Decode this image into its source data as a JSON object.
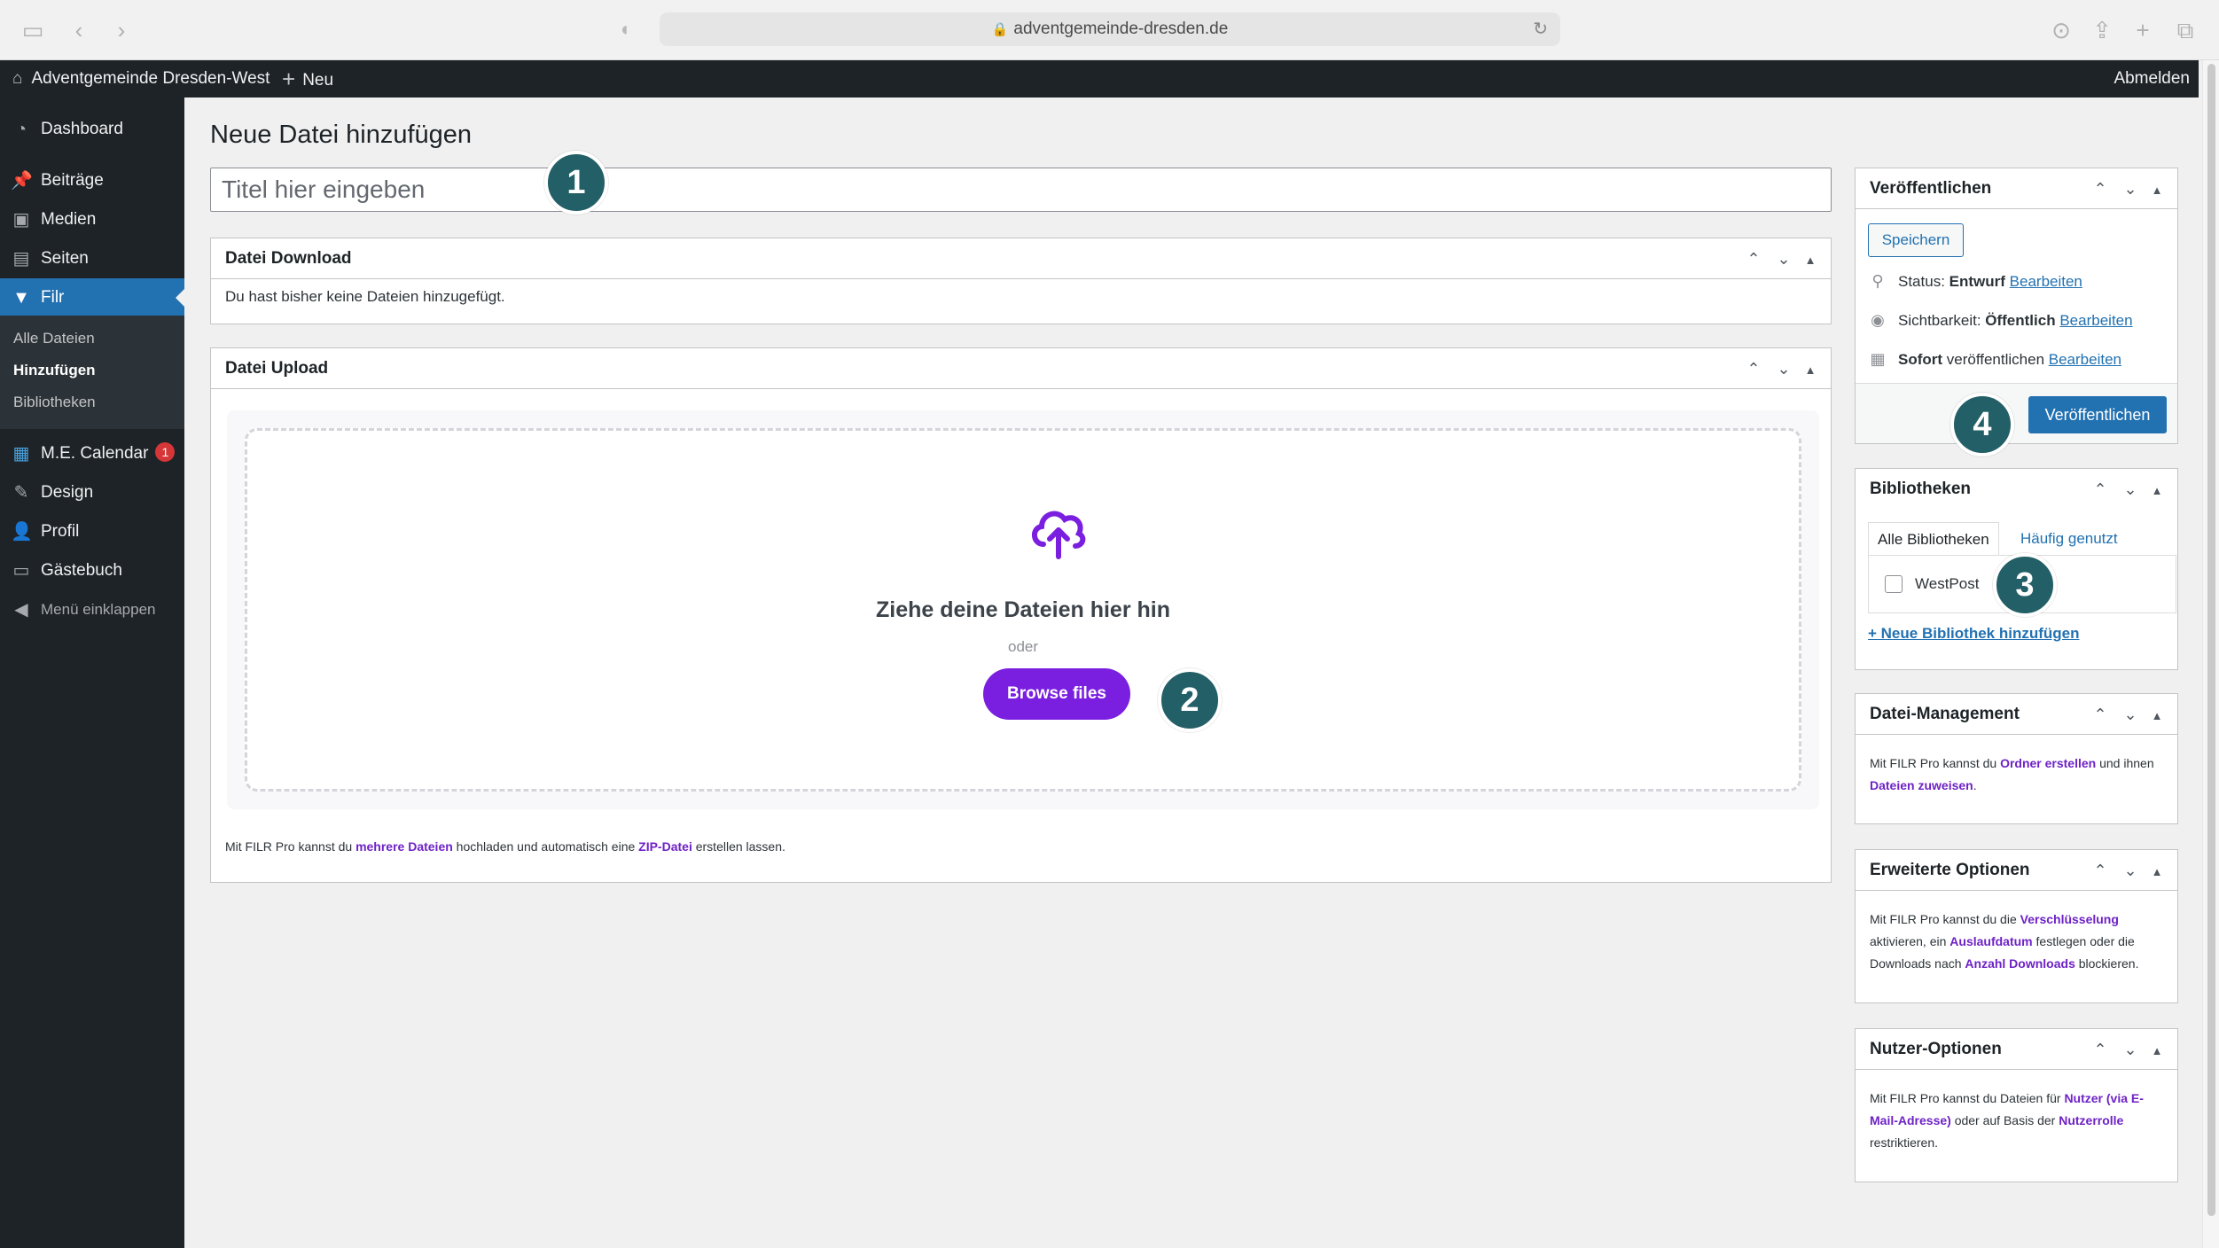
{
  "browser": {
    "url": "adventgemeinde-dresden.de"
  },
  "admin_bar": {
    "site_name": "Adventgemeinde Dresden-West",
    "new_label": "Neu",
    "logout_label": "Abmelden"
  },
  "sidebar": {
    "items": [
      {
        "label": "Dashboard",
        "icon": "dashboard-icon"
      },
      {
        "label": "Beiträge",
        "icon": "pin-icon"
      },
      {
        "label": "Medien",
        "icon": "media-icon"
      },
      {
        "label": "Seiten",
        "icon": "pages-icon"
      },
      {
        "label": "Filr",
        "icon": "filr-icon"
      },
      {
        "label": "M.E. Calendar",
        "icon": "calendar-icon",
        "badge": "1"
      },
      {
        "label": "Design",
        "icon": "brush-icon"
      },
      {
        "label": "Profil",
        "icon": "user-icon"
      },
      {
        "label": "Gästebuch",
        "icon": "guestbook-icon"
      },
      {
        "label": "Menü einklappen",
        "icon": "collapse-icon"
      }
    ],
    "submenu": [
      "Alle Dateien",
      "Hinzufügen",
      "Bibliotheken"
    ]
  },
  "main": {
    "page_title": "Neue Datei hinzufügen",
    "title_placeholder": "Titel hier eingeben",
    "download_box": {
      "title": "Datei Download",
      "empty_text": "Du hast bisher keine Dateien hinzugefügt."
    },
    "upload_box": {
      "title": "Datei Upload",
      "drop_text": "Ziehe deine Dateien hier hin",
      "or_text": "oder",
      "browse_label": "Browse files",
      "note_1": "Mit FILR Pro kannst du ",
      "note_link_1": "mehrere Dateien",
      "note_2": " hochladen und automatisch eine ",
      "note_link_2": "ZIP-Datei",
      "note_3": " erstellen lassen."
    }
  },
  "publish": {
    "title": "Veröffentlichen",
    "save_label": "Speichern",
    "status_label": "Status: ",
    "status_value": "Entwurf",
    "visibility_label": "Sichtbarkeit: ",
    "visibility_value": "Öffentlich",
    "schedule_value": "Sofort",
    "schedule_label": " veröffentlichen",
    "edit_label": "Bearbeiten",
    "publish_label": "Veröffentlichen"
  },
  "libraries": {
    "title": "Bibliotheken",
    "tab_all": "Alle Bibliotheken",
    "tab_frequent": "Häufig genutzt",
    "items": [
      "WestPost"
    ],
    "add_label": "+ Neue Bibliothek hinzufügen"
  },
  "file_management": {
    "title": "Datei-Management",
    "t1": "Mit FILR Pro kannst du ",
    "l1": "Ordner erstellen",
    "t2": " und ihnen ",
    "l2": "Dateien zuweisen",
    "t3": "."
  },
  "advanced": {
    "title": "Erweiterte Optionen",
    "t1": "Mit FILR Pro kannst du die ",
    "l1": "Verschlüsselung",
    "t2": " aktivieren, ein ",
    "l2": "Auslaufdatum",
    "t3": " festlegen oder die Downloads nach ",
    "l3": "Anzahl Downloads",
    "t4": " blockieren."
  },
  "user_options": {
    "title": "Nutzer-Optionen",
    "t1": "Mit FILR Pro kannst du Dateien für ",
    "l1": "Nutzer (via E-Mail-Adresse)",
    "t2": " oder auf Basis der ",
    "l2": "Nutzerrolle",
    "t3": " restriktieren."
  },
  "callouts": [
    "1",
    "2",
    "3",
    "4"
  ],
  "colors": {
    "admin_dark": "#1d2327",
    "wp_blue": "#2271b1",
    "filr_purple": "#7a1fe0",
    "callout_teal": "#235f67",
    "badge_red": "#d63638"
  }
}
